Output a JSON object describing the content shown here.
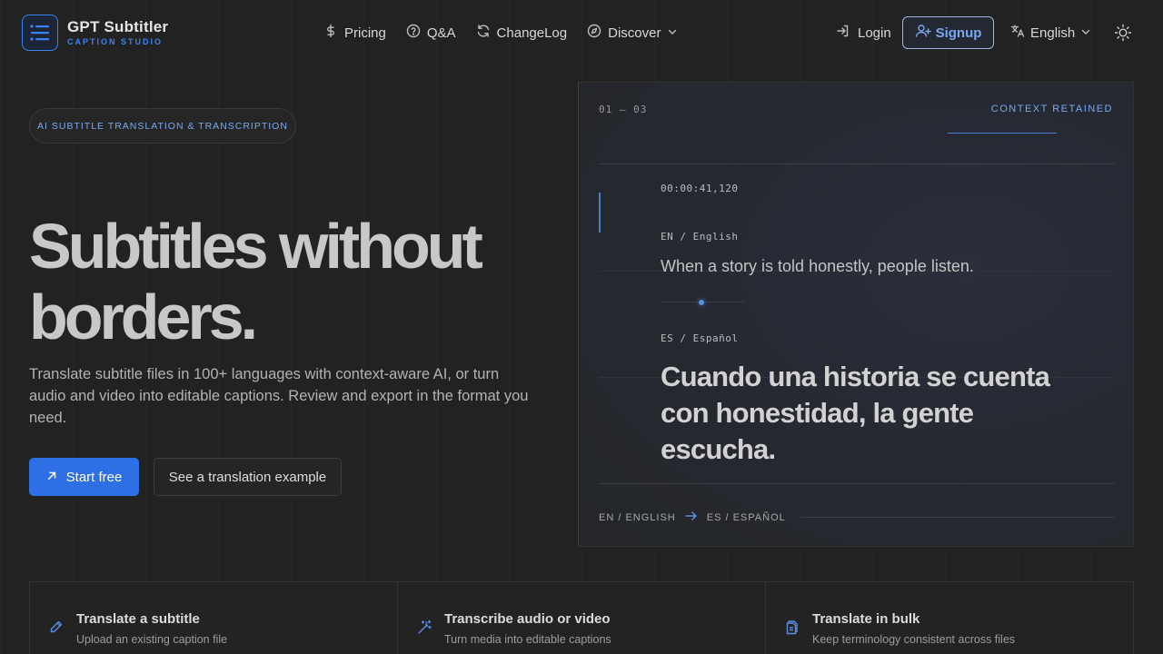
{
  "brand": {
    "title": "GPT Subtitler",
    "subtitle": "CAPTION STUDIO"
  },
  "nav": {
    "items": [
      {
        "label": "Pricing",
        "icon": "dollar-icon"
      },
      {
        "label": "Q&A",
        "icon": "question-icon"
      },
      {
        "label": "ChangeLog",
        "icon": "refresh-icon"
      },
      {
        "label": "Discover",
        "icon": "compass-icon"
      }
    ],
    "login_label": "Login",
    "signup_label": "Signup",
    "language_label": "English"
  },
  "hero": {
    "badge": "AI SUBTITLE TRANSLATION & TRANSCRIPTION",
    "headline": "Subtitles without borders.",
    "description": "Translate subtitle files in 100+ languages with context-aware AI, or turn audio and video into editable captions. Review and export in the format you need.",
    "primary_cta": "Start free",
    "secondary_cta": "See a translation example"
  },
  "panel": {
    "counter": "01 — 03",
    "context_label": "CONTEXT RETAINED",
    "timestamp": "00:00:41,120",
    "source_lang": "EN / English",
    "source_text": "When a story is told honestly, people listen.",
    "target_lang": "ES / Español",
    "target_text": "Cuando una historia se cuenta con honestidad, la gente escucha.",
    "footer_from": "EN / ENGLISH",
    "footer_to": "ES / ESPAÑOL"
  },
  "features": [
    {
      "title": "Translate a subtitle",
      "subtitle": "Upload an existing caption file",
      "icon": "pencil-icon"
    },
    {
      "title": "Transcribe audio or video",
      "subtitle": "Turn media into editable captions",
      "icon": "magic-wand-icon"
    },
    {
      "title": "Translate in bulk",
      "subtitle": "Keep terminology consistent across files",
      "icon": "files-icon"
    }
  ],
  "colors": {
    "background": "#222222",
    "accent": "#2f6fe6",
    "accent_text": "#7aa7f0"
  }
}
